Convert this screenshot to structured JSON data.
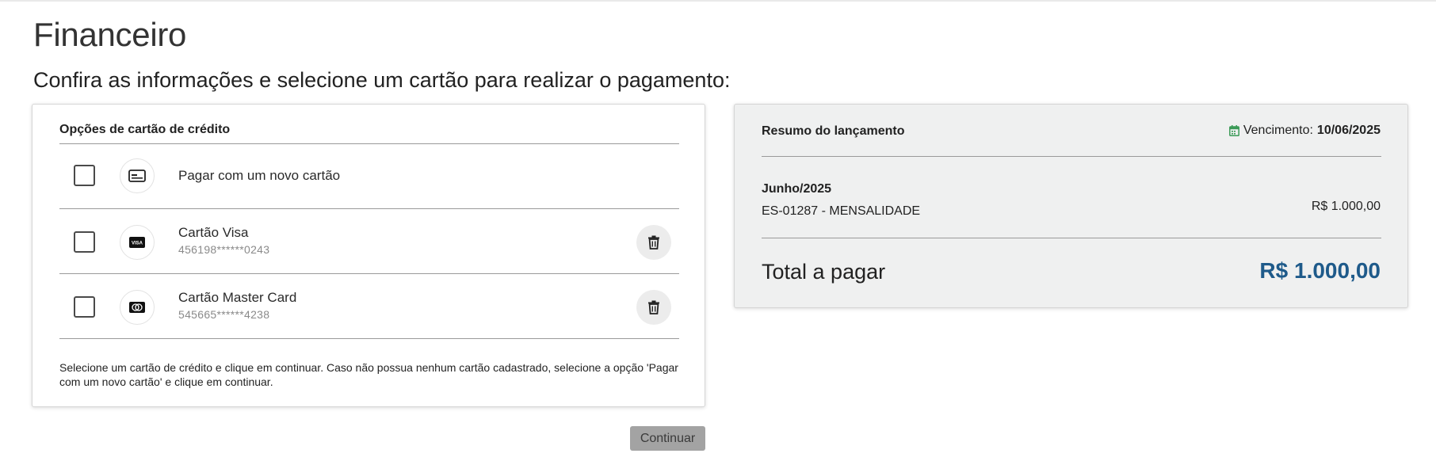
{
  "page": {
    "title": "Financeiro",
    "subtitle": "Confira as informações e selecione um cartão para realizar o pagamento:"
  },
  "card_options": {
    "header": "Opções de cartão de crédito",
    "options": [
      {
        "label": "Pagar com um novo cartão",
        "number": "",
        "icon": "credit-card-icon",
        "checked": false
      },
      {
        "label": "Cartão Visa",
        "number": "456198******0243",
        "icon": "visa-icon",
        "checked": false
      },
      {
        "label": "Cartão Master Card",
        "number": "545665******4238",
        "icon": "mastercard-icon",
        "checked": false
      }
    ],
    "help_text": "Selecione um cartão de crédito e clique em continuar. Caso não possua nenhum cartão cadastrado, selecione a opção 'Pagar com um novo cartão' e clique em continuar.",
    "visa_mark": "VISA"
  },
  "actions": {
    "continue_label": "Continuar"
  },
  "summary": {
    "title": "Resumo do lançamento",
    "due_label": "Vencimento:",
    "due_date": "10/06/2025",
    "month": "Junho/2025",
    "item_description": "ES-01287 - MENSALIDADE",
    "item_value": "R$ 1.000,00",
    "total_label": "Total a pagar",
    "total_value": "R$ 1.000,00"
  },
  "colors": {
    "total_value": "#1e5a8a",
    "calendar_icon": "#3b9a57",
    "continue_bg": "#a3a3a3"
  }
}
